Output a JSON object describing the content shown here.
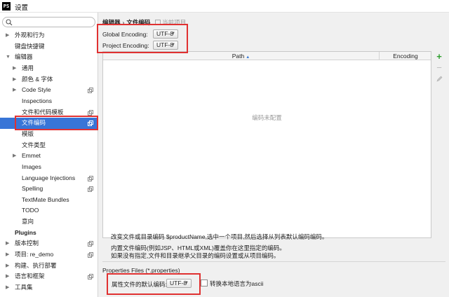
{
  "window": {
    "title": "设置",
    "icon_text": "PS"
  },
  "sidebar": {
    "search_placeholder": "",
    "items": [
      {
        "label": "外观和行为",
        "arrow": "▶",
        "bold": false
      },
      {
        "label": "键盘快捷键",
        "arrow": "",
        "bold": false
      },
      {
        "label": "编辑器",
        "arrow": "▼",
        "bold": false
      },
      {
        "label": "通用",
        "arrow": "▶",
        "bold": false
      },
      {
        "label": "颜色 & 字体",
        "arrow": "▶",
        "bold": false
      },
      {
        "label": "Code Style",
        "arrow": "▶",
        "bold": false
      },
      {
        "label": "Inspections",
        "arrow": "",
        "bold": false
      },
      {
        "label": "文件和代码模板",
        "arrow": "",
        "bold": false
      },
      {
        "label": "文件编码",
        "arrow": "",
        "bold": false
      },
      {
        "label": "模版",
        "arrow": "",
        "bold": false
      },
      {
        "label": "文件类型",
        "arrow": "",
        "bold": false
      },
      {
        "label": "Emmet",
        "arrow": "▶",
        "bold": false
      },
      {
        "label": "Images",
        "arrow": "",
        "bold": false
      },
      {
        "label": "Language Injections",
        "arrow": "",
        "bold": false
      },
      {
        "label": "Spelling",
        "arrow": "",
        "bold": false
      },
      {
        "label": "TextMate Bundles",
        "arrow": "",
        "bold": false
      },
      {
        "label": "TODO",
        "arrow": "",
        "bold": false
      },
      {
        "label": "意向",
        "arrow": "",
        "bold": false
      },
      {
        "label": "Plugins",
        "arrow": "",
        "bold": true
      },
      {
        "label": "版本控制",
        "arrow": "▶",
        "bold": false
      },
      {
        "label": "项目: re_demo",
        "arrow": "▶",
        "bold": false
      },
      {
        "label": "构建、执行部署",
        "arrow": "▶",
        "bold": false
      },
      {
        "label": "语言和框架",
        "arrow": "▶",
        "bold": false
      },
      {
        "label": "工具集",
        "arrow": "▶",
        "bold": false
      }
    ]
  },
  "breadcrumb": {
    "parent": "编辑器",
    "separator": "›",
    "current": "文件编码",
    "note": "当前项目"
  },
  "encoding": {
    "global_label": "Global Encoding:",
    "global_value": "UTF-8",
    "project_label": "Project Encoding:",
    "project_value": "UTF-8"
  },
  "table": {
    "col_path": "Path",
    "sort_arrow": "▲",
    "col_encoding": "Encoding",
    "empty_text": "编码未配置"
  },
  "toolbar": {
    "add": "+",
    "remove": "−",
    "edit": "✎"
  },
  "descriptions": {
    "line1": "改变文件或目录编码 $productName,选中一个项目,然后选择从列表默认编码编码。",
    "line2": "内置文件编码(例如JSP、HTML或XML)覆盖你在这里指定的编码。",
    "line3": "如果没有指定,文件和目录继承父目录的编码设置或从项目编码。"
  },
  "properties": {
    "heading": "Properties Files (*.properties)",
    "default_label": "属性文件的默认编码:",
    "default_value": "UTF-8",
    "transparent_label": "转换本地语言为ascii",
    "transparent_checked": false
  },
  "colors": {
    "selection": "#3875d7",
    "highlight": "#e03131",
    "add_green": "#2e9e2e"
  }
}
